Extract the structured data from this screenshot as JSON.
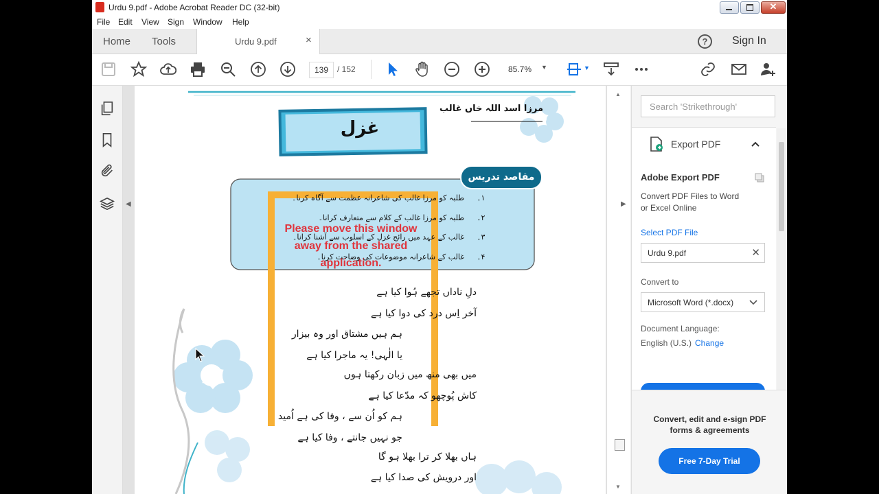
{
  "window": {
    "title": "Urdu 9.pdf - Adobe Acrobat Reader DC (32-bit)"
  },
  "menu": [
    "File",
    "Edit",
    "View",
    "Sign",
    "Window",
    "Help"
  ],
  "tabs": {
    "home": "Home",
    "tools": "Tools",
    "document": "Urdu 9.pdf",
    "close": "×"
  },
  "header": {
    "help": "?",
    "sign_in": "Sign In"
  },
  "toolbar": {
    "page_current": "139",
    "page_total": "/ 152",
    "zoom": "85.7%"
  },
  "right_pane": {
    "search_placeholder": "Search 'Strikethrough'",
    "export_title": "Export PDF",
    "card_title": "Adobe Export PDF",
    "card_desc_1": "Convert PDF Files to Word",
    "card_desc_2": "or Excel Online",
    "select_file": "Select PDF File",
    "file_name": "Urdu 9.pdf",
    "convert_to": "Convert to",
    "format": "Microsoft Word (*.docx)",
    "doc_lang_label": "Document Language:",
    "doc_lang_value": "English (U.S.)",
    "change": "Change",
    "promo_1": "Convert, edit and e-sign PDF",
    "promo_2": "forms & agreements",
    "trial": "Free 7-Day Trial"
  },
  "page": {
    "author": "مرزا اسد اللہ خاں غالب",
    "title": "غزل",
    "objectives_heading": "مقاصد تدریس",
    "objectives": [
      {
        "num": "۱۔",
        "text": "طلبہ کو مرزا غالب کی شاعرانہ عظمت سے آگاہ کرنا۔"
      },
      {
        "num": "۲۔",
        "text": "طلبہ کو مرزا غالب کے کلام سے متعارف کرانا۔"
      },
      {
        "num": "۳۔",
        "text": "غالب کے عہد میں رائج غزل کے اسلوب سے آشنا کرانا۔"
      },
      {
        "num": "۴۔",
        "text": "غالب کے شاعرانہ موضوعات کی وضاحت کرنا۔"
      }
    ],
    "verses": [
      "دلِ ناداں تجھے ہُوا کیا ہے",
      "آخر اِس درد کی دوا کیا ہے",
      "ہم ہیں مشتاق اور وہ بیزار",
      "یا الٰہی! یہ ماجرا کیا ہے",
      "میں بھی منھ میں زبان رکھتا ہوں",
      "کاش پُوچھو کہ مدّعا کیا ہے",
      "ہم کو اُن سے ، وفا کی ہے اُمید",
      "جو نہیں جانتے ، وفا کیا ہے",
      "ہاں بھلا کر ترا بھلا ہو گا",
      "اور درویش کی صدا کیا ہے"
    ]
  },
  "overlay": {
    "warning": "Please move this window away from the shared application."
  }
}
